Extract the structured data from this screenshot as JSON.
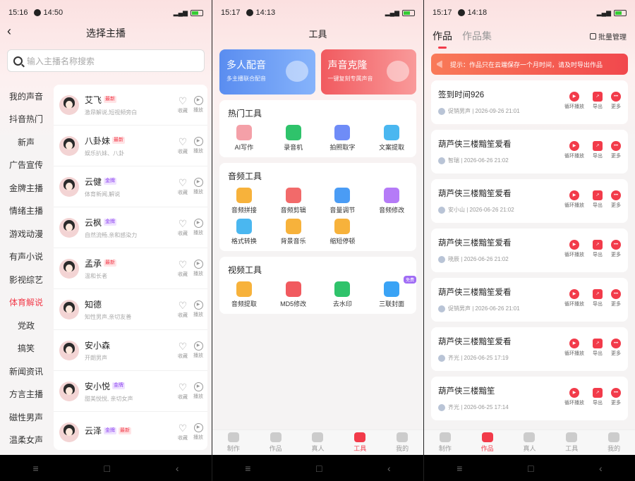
{
  "panels": {
    "select_anchor": {
      "status": {
        "time": "15:16",
        "clock_time": "14:50"
      },
      "title": "选择主播",
      "search_placeholder": "输入主播名称搜索",
      "categories": [
        "我的声音",
        "抖音热门",
        "新声",
        "广告宣传",
        "金牌主播",
        "情绪主播",
        "游戏动漫",
        "有声小说",
        "影视综艺",
        "体育解说",
        "党政",
        "搞笑",
        "新闻资讯",
        "方言主播",
        "磁性男声",
        "温柔女声"
      ],
      "active_category": "体育解说",
      "action_labels": {
        "fav": "收藏",
        "play": "播放"
      },
      "anchors": [
        {
          "name": "艾飞",
          "badges": [
            "最新"
          ],
          "desc": "激昂解说,短视频旁白"
        },
        {
          "name": "八卦妹",
          "badges": [
            "最新"
          ],
          "desc": "娱乐扒妹、八卦"
        },
        {
          "name": "云健",
          "badges": [
            "金牌"
          ],
          "desc": "体育新闻,解说"
        },
        {
          "name": "云枫",
          "badges": [
            "金牌"
          ],
          "desc": "自然流畅,亲和感染力"
        },
        {
          "name": "孟承",
          "badges": [
            "最新"
          ],
          "desc": "温和长者"
        },
        {
          "name": "知德",
          "badges": [],
          "desc": "知性男声,亲切友善"
        },
        {
          "name": "安小森",
          "badges": [],
          "desc": "开朗男声"
        },
        {
          "name": "安小悦",
          "badges": [
            "金牌"
          ],
          "desc": "甜美悦悦, 亲切女声"
        },
        {
          "name": "云泽",
          "badges": [
            "金牌",
            "最新"
          ],
          "desc": ""
        }
      ]
    },
    "tools": {
      "status": {
        "time": "15:17",
        "clock_time": "14:13"
      },
      "title": "工具",
      "big_cards": [
        {
          "title": "多人配音",
          "sub": "多主播联合配音"
        },
        {
          "title": "声音克隆",
          "sub": "一键复刻专属声音"
        }
      ],
      "sections": [
        {
          "title": "热门工具",
          "items": [
            "AI写作",
            "录音机",
            "拍照取字",
            "文案提取"
          ]
        },
        {
          "title": "音频工具",
          "items": [
            "音频拼接",
            "音频剪辑",
            "音量调节",
            "音频修改",
            "格式转换",
            "背景音乐",
            "缩短停顿"
          ]
        },
        {
          "title": "视频工具",
          "items": [
            "音频提取",
            "MD5修改",
            "去水印",
            "三联封面"
          ]
        }
      ],
      "free_badge": "免费"
    },
    "works": {
      "status": {
        "time": "15:17",
        "clock_time": "14:18"
      },
      "tabs": [
        "作品",
        "作品集"
      ],
      "batch": "批量管理",
      "tip": "提示：作品只在云端保存一个月时间，请及时导出作品",
      "action_labels": [
        "循环播放",
        "导出",
        "更多"
      ],
      "items": [
        {
          "title": "签到时间926",
          "meta": "促销男声 | 2026-09-26 21:01"
        },
        {
          "title": "葫芦侠三楼黯笙爱看",
          "meta": "智瑞 | 2026-06-26 21:02"
        },
        {
          "title": "葫芦侠三楼黯笙爱看",
          "meta": "安小山 | 2026-06-26 21:02"
        },
        {
          "title": "葫芦侠三楼黯笙爱看",
          "meta": "晓辰 | 2026-06-26 21:02"
        },
        {
          "title": "葫芦侠三楼黯笙爱看",
          "meta": "促销男声 | 2026-06-26 21:01"
        },
        {
          "title": "葫芦侠三楼黯笙爱看",
          "meta": "齐光 | 2026-06-25 17:19"
        },
        {
          "title": "葫芦侠三楼黯笙",
          "meta": "齐光 | 2026-06-25 17:14"
        }
      ]
    }
  },
  "tabbar": [
    "制作",
    "作品",
    "真人",
    "工具",
    "我的"
  ],
  "colors": {
    "accent": "#f23b4a",
    "gold": "#8a3ff0"
  }
}
